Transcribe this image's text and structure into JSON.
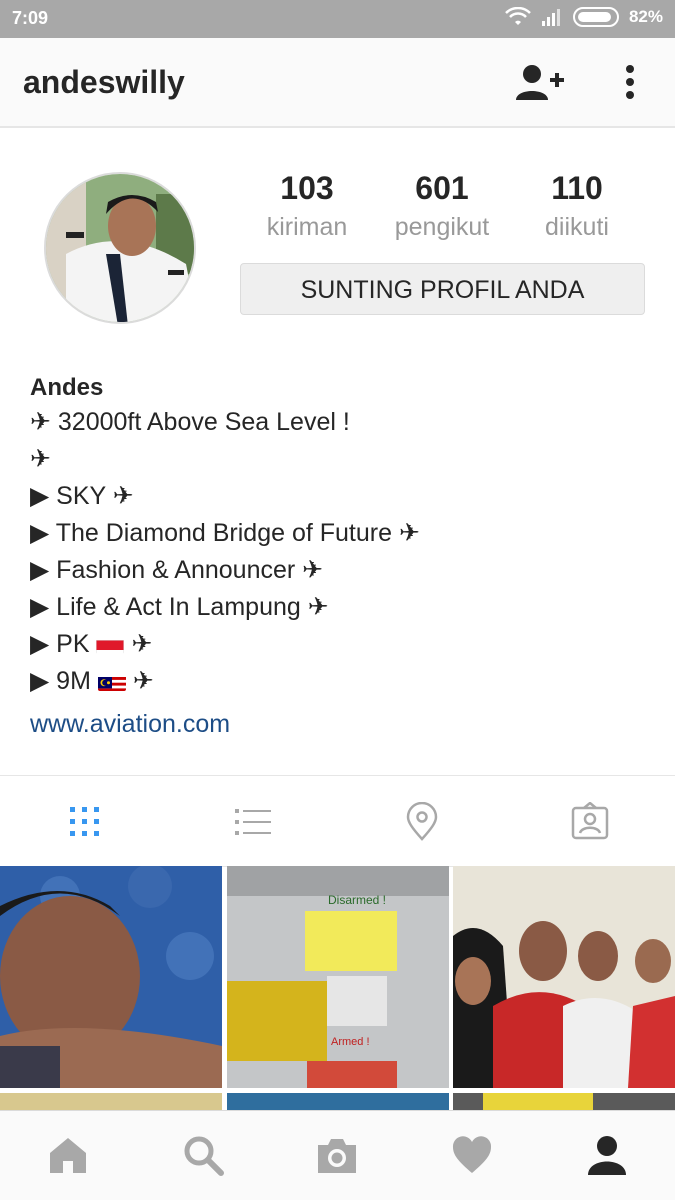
{
  "status_bar": {
    "time": "7:09",
    "battery": "82%",
    "icons": [
      "wifi-icon",
      "signal-icon",
      "battery-icon"
    ]
  },
  "header": {
    "username": "andeswilly",
    "icons": [
      "add-user-icon",
      "more-vert-icon"
    ]
  },
  "stats": [
    {
      "value": "103",
      "label": "kiriman"
    },
    {
      "value": "601",
      "label": "pengikut"
    },
    {
      "value": "110",
      "label": "diikuti"
    }
  ],
  "edit_profile_label": "SUNTING PROFIL ANDA",
  "bio": {
    "name": "Andes",
    "lines": [
      "✈ 32000ft Above Sea Level !",
      "✈",
      "▶ SKY ✈",
      "▶ The Diamond Bridge of Future ✈",
      "▶ Fashion & Announcer ✈",
      "▶ Life & Act In Lampung ✈"
    ],
    "pk_prefix": "▶ PK",
    "pk_suffix": "✈",
    "m_prefix": "▶ 9M",
    "m_suffix": "✈",
    "website": "www.aviation.com"
  },
  "tabs": [
    "grid-icon",
    "list-icon",
    "location-pin-icon",
    "tagged-icon"
  ],
  "grid_texts": {
    "disarmed": "Disarmed !",
    "armed": "Armed !"
  },
  "bottom_nav": [
    "home-icon",
    "search-icon",
    "camera-icon",
    "heart-icon",
    "profile-icon"
  ],
  "colors": {
    "accent": "#3897f0",
    "link": "#1d4d86",
    "icon_gray": "#a8a8a8"
  }
}
